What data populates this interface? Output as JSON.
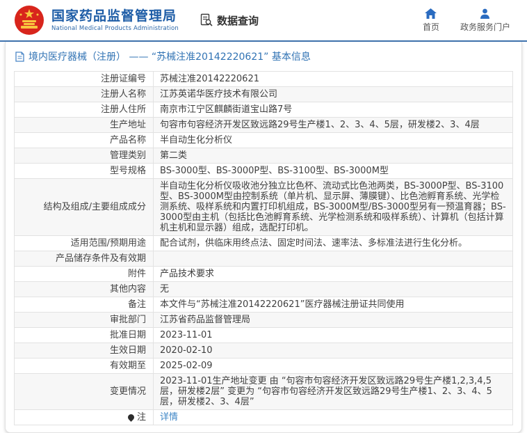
{
  "colors": {
    "brand_blue": "#1d5ca6",
    "header_line_blue": "#3f73ae",
    "nav_icon_blue": "#2a6bc0",
    "breadcrumb_blue": "#3173b4",
    "link_blue": "#3e86c6",
    "emblem_red": "#d8251c",
    "emblem_gold": "#f8c63f",
    "zebra_row": "#f7f7f7",
    "border_gray": "#e2e2e2"
  },
  "header": {
    "title": "国家药品监督管理局",
    "subtitle": "National Medical Products Administration",
    "data_query_label": "数据查询",
    "home_label": "首页",
    "portal_label": "政务服务门户"
  },
  "breadcrumb": {
    "text": "境内医疗器械（注册） —— “苏械注准20142220621” 基本信息"
  },
  "info_table": {
    "rows": [
      {
        "label": "注册证编号",
        "value": "苏械注准20142220621"
      },
      {
        "label": "注册人名称",
        "value": "江苏英诺华医疗技术有限公司"
      },
      {
        "label": "注册人住所",
        "value": "南京市江宁区麒麟街道宝山路7号"
      },
      {
        "label": "生产地址",
        "value": "句容市句容经济开发区致远路29号生产楼1、2、3、4、5层，研发楼2、3、4层"
      },
      {
        "label": "产品名称",
        "value": "半自动生化分析仪"
      },
      {
        "label": "管理类别",
        "value": "第二类"
      },
      {
        "label": "型号规格",
        "value": "BS-3000型、BS-3000P型、BS-3100型、BS-3000M型"
      },
      {
        "label": "结构及组成/主要组成成分",
        "value": "半自动生化分析仪吸收池分独立比色杯、流动式比色池两类，BS-3000P型、BS-3100型、BS-3000M型由控制系统（单片机、显示屏、薄膜键）、比色池孵育系统、光学检测系统、吸样系统和内置打印机组成，BS-3000M型/BS-3000型另有一预温育器；BS-3000型由主机（包括比色池孵育系统、光学检测系统和吸样系统）、计算机（包括计算机主机和显示器）组成，选配打印机。"
      },
      {
        "label": "适用范围/预期用途",
        "value": "配合试剂，供临床用终点法、固定时间法、速率法、多标准法进行生化分析。"
      },
      {
        "label": "产品储存条件及有效期",
        "value": ""
      },
      {
        "label": "附件",
        "value": "产品技术要求"
      },
      {
        "label": "其他内容",
        "value": "无"
      },
      {
        "label": "备注",
        "value": "本文件与“苏械注准20142220621”医疗器械注册证共同使用"
      },
      {
        "label": "审批部门",
        "value": "江苏省药品监督管理局"
      },
      {
        "label": "批准日期",
        "value": "2023-11-01"
      },
      {
        "label": "生效日期",
        "value": "2020-02-10"
      },
      {
        "label": "有效期至",
        "value": "2025-02-09"
      },
      {
        "label": "变更情况",
        "value": "2023-11-01生产地址变更 由 “句容市句容经济开发区致远路29号生产楼1,2,3,4,5层，研发楼2层” 变更为 “句容市句容经济开发区致远路29号生产楼1、2、3、4、5层，研发楼2、3、4层”"
      },
      {
        "label": "注",
        "value": "详情",
        "label_icon": "note-pin-icon",
        "value_is_link": true
      }
    ]
  }
}
